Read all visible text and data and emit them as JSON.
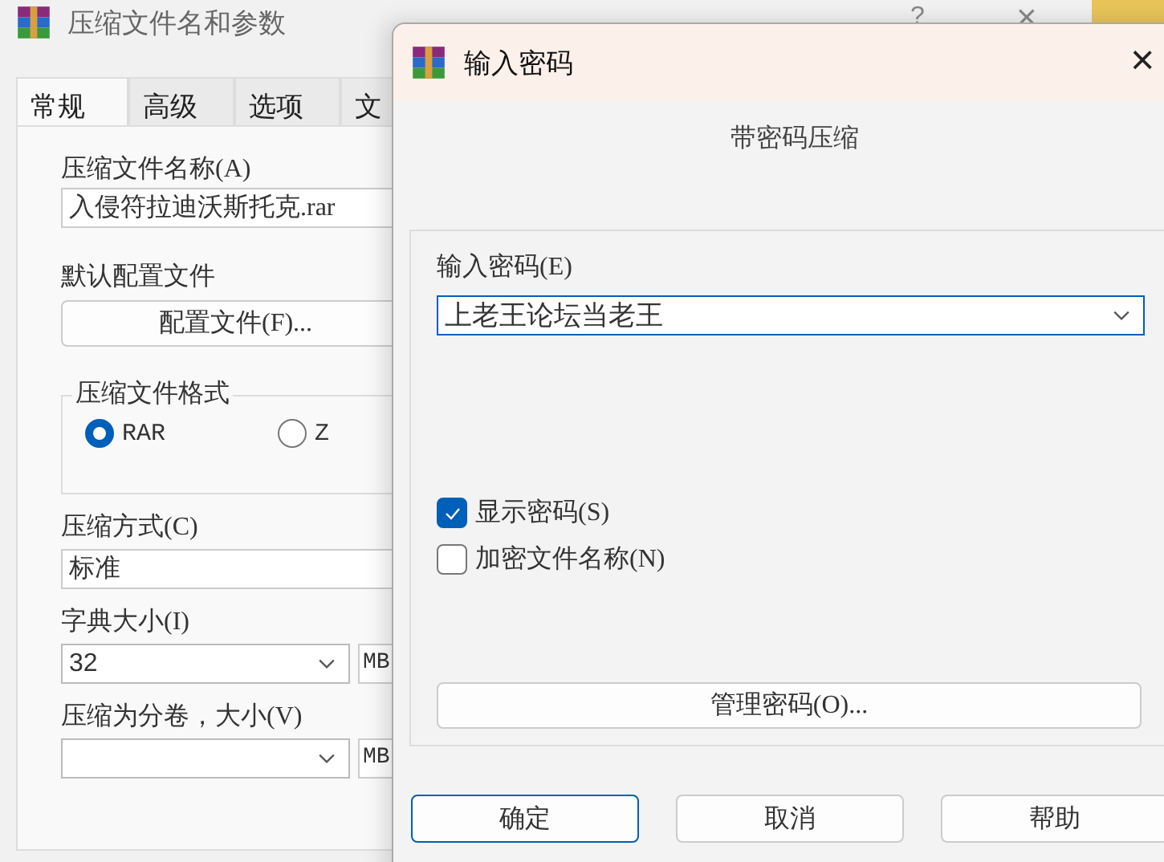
{
  "background_window": {
    "title": "压缩文件名和参数",
    "help": "?",
    "close": "×",
    "tabs": [
      {
        "label": "常规",
        "selected": true
      },
      {
        "label": "高级",
        "selected": false
      },
      {
        "label": "选项",
        "selected": false
      },
      {
        "label": "文",
        "selected": false
      }
    ],
    "archive_name": {
      "label": "压缩文件名称(A)",
      "value": "入侵符拉迪沃斯托克.rar"
    },
    "profile": {
      "label": "默认配置文件",
      "button": "配置文件(F)..."
    },
    "format": {
      "legend": "压缩文件格式",
      "options": [
        {
          "label": "RAR",
          "selected": true
        },
        {
          "label": "Z",
          "selected": false
        }
      ]
    },
    "method": {
      "label": "压缩方式(C)",
      "value": "标准"
    },
    "dictionary": {
      "label": "字典大小(I)",
      "value": "32",
      "unit": "MB"
    },
    "volumes": {
      "label": "压缩为分卷，大小(V)",
      "unit": "MB"
    }
  },
  "dialog": {
    "title": "输入密码",
    "close": "×",
    "heading": "带密码压缩",
    "password_label": "输入密码(E)",
    "password_value": "上老王论坛当老王",
    "checkboxes": [
      {
        "label": "显示密码(S)",
        "checked": true
      },
      {
        "label": "加密文件名称(N)",
        "checked": false
      }
    ],
    "manage_button": "管理密码(O)...",
    "buttons": [
      {
        "label": "确定",
        "default": true
      },
      {
        "label": "取消",
        "default": false
      },
      {
        "label": "帮助",
        "default": false
      }
    ]
  }
}
